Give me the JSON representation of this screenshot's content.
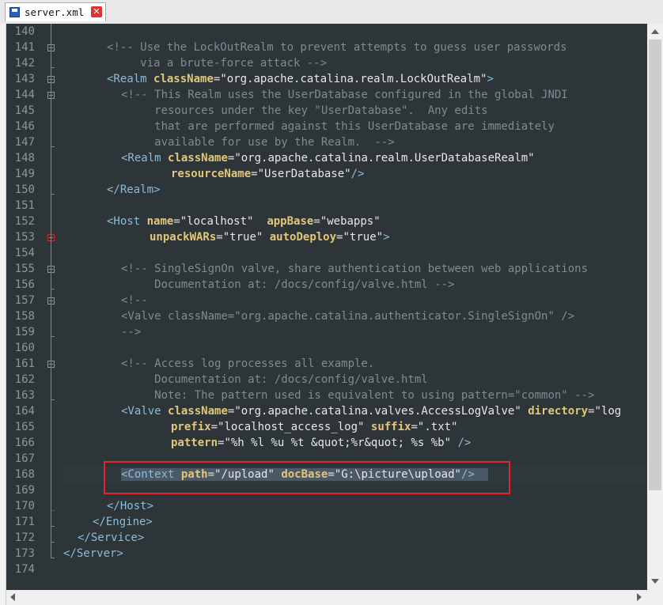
{
  "tab": {
    "filename": "server.xml",
    "save_icon": "save-icon",
    "close_glyph": "✕"
  },
  "lines": [
    {
      "n": "140"
    },
    {
      "n": "141"
    },
    {
      "n": "142"
    },
    {
      "n": "143"
    },
    {
      "n": "144"
    },
    {
      "n": "145"
    },
    {
      "n": "146"
    },
    {
      "n": "147"
    },
    {
      "n": "148"
    },
    {
      "n": "149"
    },
    {
      "n": "150"
    },
    {
      "n": "151"
    },
    {
      "n": "152"
    },
    {
      "n": "153"
    },
    {
      "n": "154"
    },
    {
      "n": "155"
    },
    {
      "n": "156"
    },
    {
      "n": "157"
    },
    {
      "n": "158"
    },
    {
      "n": "159"
    },
    {
      "n": "160"
    },
    {
      "n": "161"
    },
    {
      "n": "162"
    },
    {
      "n": "163"
    },
    {
      "n": "164"
    },
    {
      "n": "165"
    },
    {
      "n": "166"
    },
    {
      "n": "167"
    },
    {
      "n": "168"
    },
    {
      "n": "169"
    },
    {
      "n": "170"
    },
    {
      "n": "171"
    },
    {
      "n": "172"
    },
    {
      "n": "173"
    },
    {
      "n": "174"
    }
  ],
  "code": {
    "l141": "<!-- Use the LockOutRealm to prevent attempts to guess user passwords",
    "l142": "     via a brute-force attack -->",
    "l143_open": "<Realm",
    "l143_attr": "className",
    "l143_val": "\"org.apache.catalina.realm.LockOutRealm\"",
    "l143_close": ">",
    "l144": "<!-- This Realm uses the UserDatabase configured in the global JNDI",
    "l145": "     resources under the key \"UserDatabase\".  Any edits",
    "l146": "     that are performed against this UserDatabase are immediately",
    "l147": "     available for use by the Realm.  -->",
    "l148_open": "<Realm",
    "l148_attr": "className",
    "l148_val": "\"org.apache.catalina.realm.UserDatabaseRealm\"",
    "l149_attr": "resourceName",
    "l149_val": "\"UserDatabase\"",
    "l149_close": "/>",
    "l150": "</Realm>",
    "l152_open": "<Host",
    "l152_attr1": "name",
    "l152_val1": "\"localhost\"",
    "l152_attr2": "appBase",
    "l152_val2": "\"webapps\"",
    "l153_attr1": "unpackWARs",
    "l153_val1": "\"true\"",
    "l153_attr2": "autoDeploy",
    "l153_val2": "\"true\"",
    "l153_close": ">",
    "l155": "<!-- SingleSignOn valve, share authentication between web applications",
    "l156": "     Documentation at: /docs/config/valve.html -->",
    "l157": "<!--",
    "l158": "<Valve className=\"org.apache.catalina.authenticator.SingleSignOn\" />",
    "l159": "-->",
    "l161": "<!-- Access log processes all example.",
    "l162": "     Documentation at: /docs/config/valve.html",
    "l163": "     Note: The pattern used is equivalent to using pattern=\"common\" -->",
    "l164_open": "<Valve",
    "l164_attr1": "className",
    "l164_val1": "\"org.apache.catalina.valves.AccessLogValve\"",
    "l164_attr2": "directory",
    "l164_val2": "\"log",
    "l165_attr1": "prefix",
    "l165_val1": "\"localhost_access_log\"",
    "l165_attr2": "suffix",
    "l165_val2": "\".txt\"",
    "l166_attr": "pattern",
    "l166_val": "\"%h %l %u %t &quot;%r&quot; %s %b\"",
    "l166_close": "/>",
    "l168_open": "<Context",
    "l168_attr1": "path",
    "l168_val1": "\"/upload\"",
    "l168_attr2": "docBase",
    "l168_val2": "\"G:\\picture\\upload\"",
    "l168_close": "/>",
    "l170": "</Host>",
    "l171": "</Engine>",
    "l172": "</Service>",
    "l173": "</Server>"
  },
  "colors": {
    "editor_bg": "#2d3538",
    "tag": "#8cbbd9",
    "attr": "#e2c67a",
    "comment": "#7d8c93",
    "highlight_box": "#e8242a"
  }
}
